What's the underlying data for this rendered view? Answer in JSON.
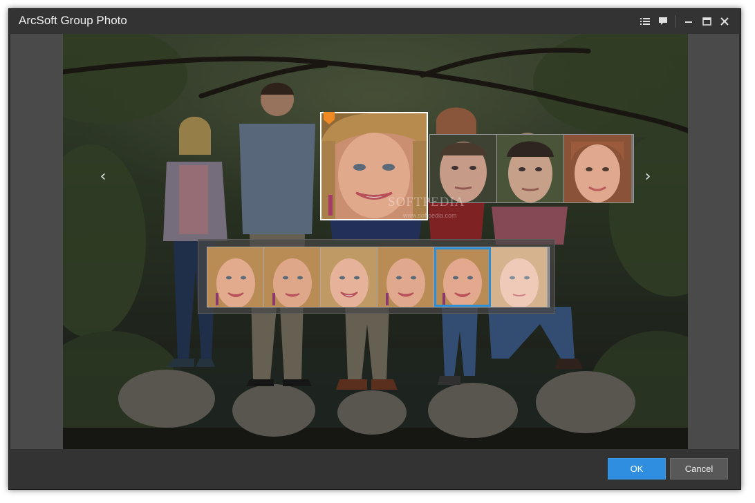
{
  "window": {
    "title": "ArcSoft Group Photo"
  },
  "titlebar_icons": [
    "list-icon",
    "comment-icon",
    "minimize-icon",
    "maximize-icon",
    "close-icon"
  ],
  "watermark": {
    "brand": "SOFTPEDIA",
    "url": "www.softpedia.com"
  },
  "arrows": {
    "left": "‹",
    "right": "›"
  },
  "face_strip": {
    "faces": [
      "face-woman-blonde-selected",
      "face-man-1",
      "face-man-2",
      "face-woman-2"
    ]
  },
  "expression_strip": {
    "selected_index": 4,
    "count": 6
  },
  "footer": {
    "ok_label": "OK",
    "cancel_label": "Cancel"
  },
  "colors": {
    "accent": "#2f8ee0",
    "marker": "#f08a24",
    "titlebar": "#333333"
  }
}
